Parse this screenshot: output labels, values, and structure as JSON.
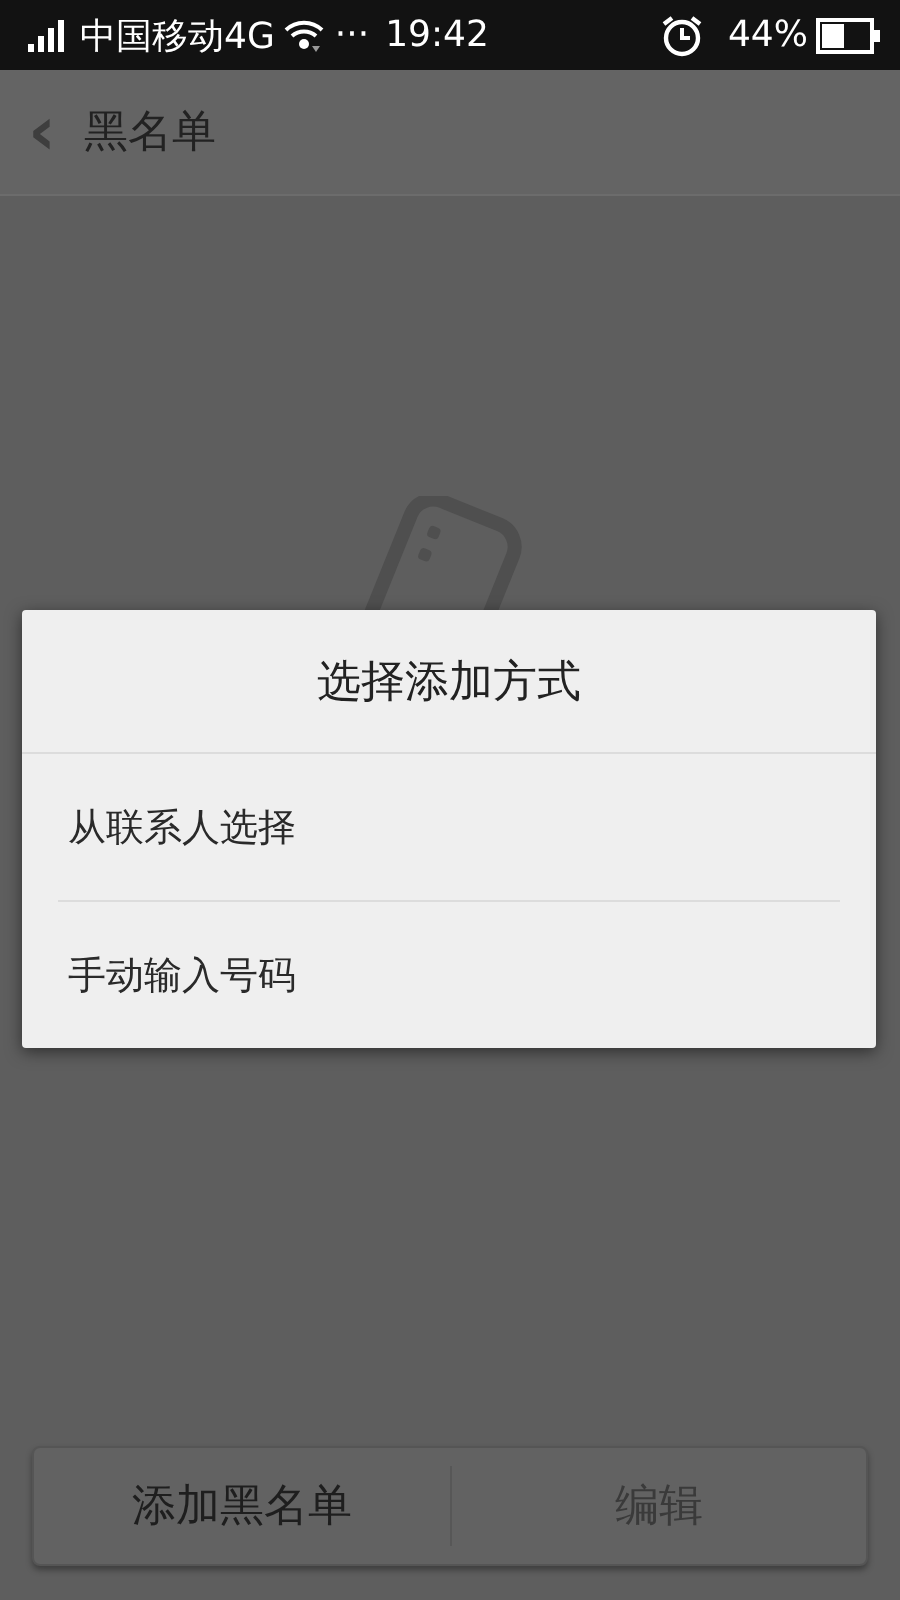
{
  "status_bar": {
    "carrier": "中国移动4G",
    "more": "···",
    "time": "19:42",
    "battery": "44%"
  },
  "header": {
    "back": "‹",
    "title": "黑名单"
  },
  "bottom_bar": {
    "buttons": [
      {
        "label": "添加黑名单",
        "disabled": false
      },
      {
        "label": "编辑",
        "disabled": true
      }
    ]
  },
  "dialog": {
    "title": "选择添加方式",
    "options": [
      "从联系人选择",
      "手动输入号码"
    ]
  }
}
